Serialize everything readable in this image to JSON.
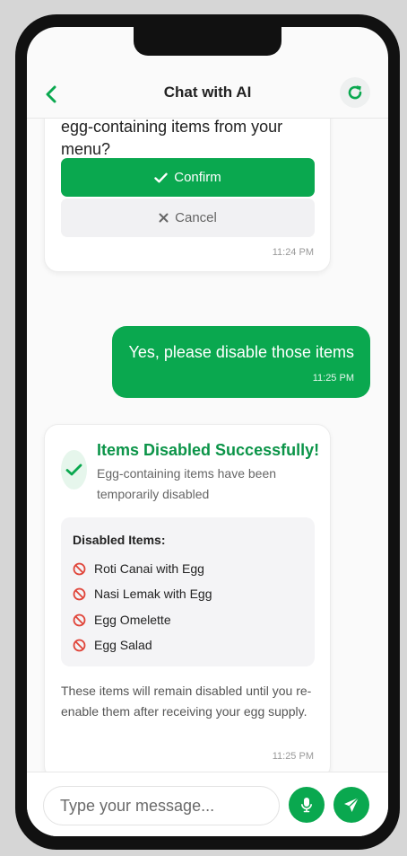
{
  "header": {
    "title": "Chat with AI",
    "back_icon": "chevron-left-icon",
    "refresh_icon": "refresh-icon"
  },
  "messages": {
    "confirm_prompt": {
      "text": "egg-containing items from your menu?",
      "confirm_label": "Confirm",
      "cancel_label": "Cancel",
      "time": "11:24 PM"
    },
    "user_reply": {
      "text": "Yes, please disable those items",
      "time": "11:25 PM"
    },
    "result": {
      "title": "Items Disabled Successfully!",
      "subtitle": "Egg-containing items have been temporarily disabled",
      "list_heading": "Disabled Items:",
      "items": [
        "Roti Canai with Egg",
        "Nasi Lemak with Egg",
        "Egg Omelette",
        "Egg Salad"
      ],
      "note": "These items will remain disabled until you re-enable them after receiving your egg supply.",
      "time": "11:25 PM"
    }
  },
  "composer": {
    "placeholder": "Type your message...",
    "mic_icon": "microphone-icon",
    "send_icon": "send-icon"
  },
  "colors": {
    "accent": "#0aa84f",
    "success_text": "#0b9448",
    "ban_red": "#e0453a"
  }
}
